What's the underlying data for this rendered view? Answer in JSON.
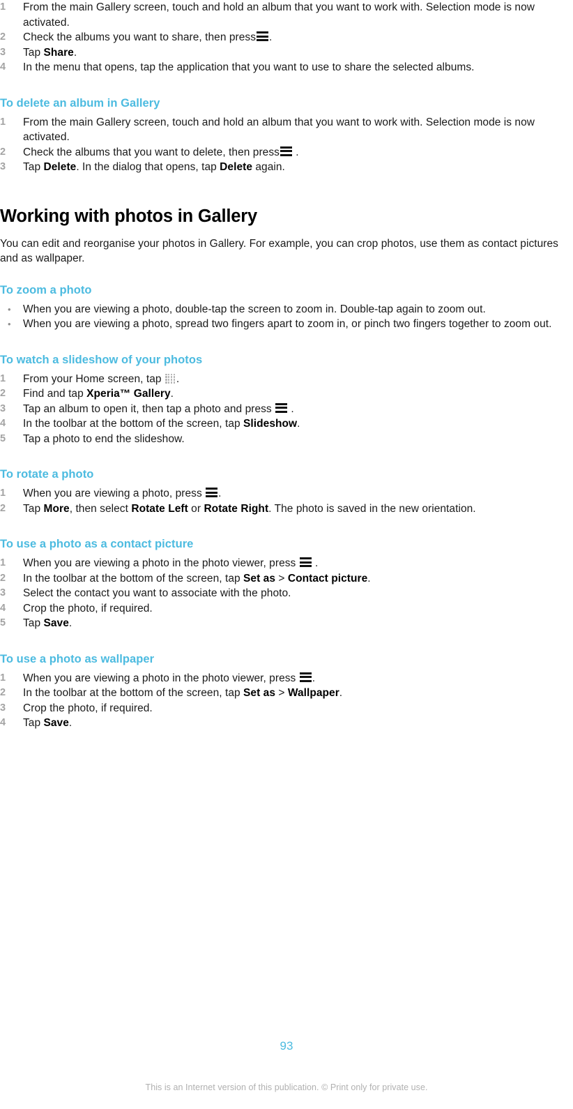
{
  "document": {
    "type": "user-guide-page",
    "page_number": "93",
    "footer_note": "This is an Internet version of this publication. © Print only for private use.",
    "accent_color": "#4cbbe0",
    "marker_color": "#a3a3a3",
    "text_color": "#1a1a1a",
    "footer_color": "#b0b0b0"
  },
  "blocks": [
    {
      "id": "share-albums-steps",
      "kind": "ordered-list",
      "items": [
        {
          "number": "1",
          "segments": [
            {
              "t": "text",
              "v": "From the main Gallery screen, touch and hold an album that you want to work with. Selection mode is now activated."
            }
          ]
        },
        {
          "number": "2",
          "segments": [
            {
              "t": "text",
              "v": "Check the albums you want to share, then press"
            },
            {
              "t": "icon",
              "v": "menu-icon"
            },
            {
              "t": "text",
              "v": "."
            }
          ]
        },
        {
          "number": "3",
          "segments": [
            {
              "t": "text",
              "v": "Tap "
            },
            {
              "t": "bold",
              "v": "Share"
            },
            {
              "t": "text",
              "v": "."
            }
          ]
        },
        {
          "number": "4",
          "segments": [
            {
              "t": "text",
              "v": "In the menu that opens, tap the application that you want to use to share the selected albums."
            }
          ]
        }
      ]
    },
    {
      "id": "delete-album-heading",
      "kind": "sub-heading",
      "text": "To delete an album in Gallery"
    },
    {
      "id": "delete-album-steps",
      "kind": "ordered-list",
      "items": [
        {
          "number": "1",
          "segments": [
            {
              "t": "text",
              "v": "From the main Gallery screen, touch and hold an album that you want to work with. Selection mode is now activated."
            }
          ]
        },
        {
          "number": "2",
          "segments": [
            {
              "t": "text",
              "v": "Check the albums that you want to delete, then press"
            },
            {
              "t": "icon",
              "v": "menu-icon"
            },
            {
              "t": "text",
              "v": " ."
            }
          ]
        },
        {
          "number": "3",
          "segments": [
            {
              "t": "text",
              "v": "Tap "
            },
            {
              "t": "bold",
              "v": "Delete"
            },
            {
              "t": "text",
              "v": ". In the dialog that opens, tap "
            },
            {
              "t": "bold",
              "v": "Delete"
            },
            {
              "t": "text",
              "v": " again."
            }
          ]
        }
      ]
    },
    {
      "id": "working-with-photos-heading",
      "kind": "section-heading",
      "text": "Working with photos in Gallery"
    },
    {
      "id": "working-with-photos-intro",
      "kind": "paragraph",
      "text": "You can edit and reorganise your photos in Gallery. For example, you can crop photos, use them as contact pictures and as wallpaper."
    },
    {
      "id": "zoom-photo-heading",
      "kind": "sub-heading",
      "text": "To zoom a photo"
    },
    {
      "id": "zoom-photo-steps",
      "kind": "bulleted-list",
      "items": [
        {
          "number": "•",
          "segments": [
            {
              "t": "text",
              "v": "When you are viewing a photo, double-tap the screen to zoom in. Double-tap again to zoom out."
            }
          ]
        },
        {
          "number": "•",
          "segments": [
            {
              "t": "text",
              "v": "When you are viewing a photo, spread two fingers apart to zoom in, or pinch two fingers together to zoom out."
            }
          ]
        }
      ]
    },
    {
      "id": "slideshow-heading",
      "kind": "sub-heading",
      "text": "To watch a slideshow of your photos"
    },
    {
      "id": "slideshow-steps",
      "kind": "ordered-list",
      "items": [
        {
          "number": "1",
          "segments": [
            {
              "t": "text",
              "v": "From your Home screen, tap "
            },
            {
              "t": "icon",
              "v": "app-grid-icon"
            },
            {
              "t": "text",
              "v": "."
            }
          ]
        },
        {
          "number": "2",
          "segments": [
            {
              "t": "text",
              "v": "Find and tap "
            },
            {
              "t": "bold",
              "v": "Xperia™ Gallery"
            },
            {
              "t": "text",
              "v": "."
            }
          ]
        },
        {
          "number": "3",
          "segments": [
            {
              "t": "text",
              "v": "Tap an album to open it, then tap a photo and press "
            },
            {
              "t": "icon",
              "v": "menu-icon"
            },
            {
              "t": "text",
              "v": " ."
            }
          ]
        },
        {
          "number": "4",
          "segments": [
            {
              "t": "text",
              "v": "In the toolbar at the bottom of the screen, tap "
            },
            {
              "t": "bold",
              "v": "Slideshow"
            },
            {
              "t": "text",
              "v": "."
            }
          ]
        },
        {
          "number": "5",
          "segments": [
            {
              "t": "text",
              "v": "Tap a photo to end the slideshow."
            }
          ]
        }
      ]
    },
    {
      "id": "rotate-photo-heading",
      "kind": "sub-heading",
      "text": "To rotate a photo"
    },
    {
      "id": "rotate-photo-steps",
      "kind": "ordered-list",
      "items": [
        {
          "number": "1",
          "segments": [
            {
              "t": "text",
              "v": "When you are viewing a photo, press "
            },
            {
              "t": "icon",
              "v": "menu-icon"
            },
            {
              "t": "text",
              "v": "."
            }
          ]
        },
        {
          "number": "2",
          "segments": [
            {
              "t": "text",
              "v": "Tap "
            },
            {
              "t": "bold",
              "v": "More"
            },
            {
              "t": "text",
              "v": ", then select "
            },
            {
              "t": "bold",
              "v": "Rotate Left"
            },
            {
              "t": "text",
              "v": " or "
            },
            {
              "t": "bold",
              "v": "Rotate Right"
            },
            {
              "t": "text",
              "v": ". The photo is saved in the new orientation."
            }
          ]
        }
      ]
    },
    {
      "id": "contact-picture-heading",
      "kind": "sub-heading",
      "text": "To use a photo as a contact picture"
    },
    {
      "id": "contact-picture-steps",
      "kind": "ordered-list",
      "items": [
        {
          "number": "1",
          "segments": [
            {
              "t": "text",
              "v": "When you are viewing a photo in the photo viewer, press "
            },
            {
              "t": "icon",
              "v": "menu-icon"
            },
            {
              "t": "text",
              "v": " ."
            }
          ]
        },
        {
          "number": "2",
          "segments": [
            {
              "t": "text",
              "v": "In the toolbar at the bottom of the screen, tap "
            },
            {
              "t": "bold",
              "v": "Set as"
            },
            {
              "t": "text",
              "v": " > "
            },
            {
              "t": "bold",
              "v": "Contact picture"
            },
            {
              "t": "text",
              "v": "."
            }
          ]
        },
        {
          "number": "3",
          "segments": [
            {
              "t": "text",
              "v": "Select the contact you want to associate with the photo."
            }
          ]
        },
        {
          "number": "4",
          "segments": [
            {
              "t": "text",
              "v": "Crop the photo, if required."
            }
          ]
        },
        {
          "number": "5",
          "segments": [
            {
              "t": "text",
              "v": "Tap "
            },
            {
              "t": "bold",
              "v": "Save"
            },
            {
              "t": "text",
              "v": "."
            }
          ]
        }
      ]
    },
    {
      "id": "wallpaper-heading",
      "kind": "sub-heading",
      "text": "To use a photo as wallpaper"
    },
    {
      "id": "wallpaper-steps",
      "kind": "ordered-list",
      "items": [
        {
          "number": "1",
          "segments": [
            {
              "t": "text",
              "v": "When you are viewing a photo in the photo viewer, press "
            },
            {
              "t": "icon",
              "v": "menu-icon"
            },
            {
              "t": "text",
              "v": "."
            }
          ]
        },
        {
          "number": "2",
          "segments": [
            {
              "t": "text",
              "v": "In the toolbar at the bottom of the screen, tap "
            },
            {
              "t": "bold",
              "v": "Set as"
            },
            {
              "t": "text",
              "v": " > "
            },
            {
              "t": "bold",
              "v": "Wallpaper"
            },
            {
              "t": "text",
              "v": "."
            }
          ]
        },
        {
          "number": "3",
          "segments": [
            {
              "t": "text",
              "v": "Crop the photo, if required."
            }
          ]
        },
        {
          "number": "4",
          "segments": [
            {
              "t": "text",
              "v": "Tap "
            },
            {
              "t": "bold",
              "v": "Save"
            },
            {
              "t": "text",
              "v": "."
            }
          ]
        }
      ]
    }
  ]
}
